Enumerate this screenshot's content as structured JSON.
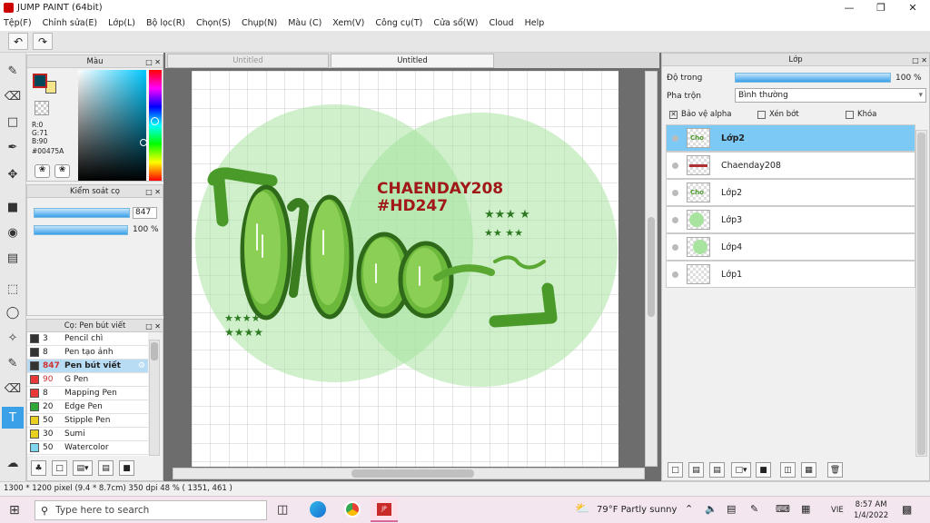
{
  "window": {
    "title": "JUMP PAINT (64bit)"
  },
  "menu": [
    "Tệp(F)",
    "Chỉnh sửa(E)",
    "Lớp(L)",
    "Bộ lọc(R)",
    "Chọn(S)",
    "Chụp(N)",
    "Màu (C)",
    "Xem(V)",
    "Công cụ(T)",
    "Cửa sổ(W)",
    "Cloud",
    "Help"
  ],
  "color_panel": {
    "title": "Màu",
    "r": "R:0",
    "g": "G:71",
    "b": "B:90",
    "hex": "#00475A",
    "fg_color": "#00475A",
    "bg_color": "#f6e58a"
  },
  "brush_control": {
    "title": "Kiểm soát cọ",
    "size": "847",
    "opacity": "100 %",
    "size_fraction": 1.0,
    "opacity_fraction": 1.0
  },
  "brush_list": {
    "title": "Cọ: Pen bút viết",
    "items": [
      {
        "num": "3",
        "name": "Pencil chì",
        "color": "#333333"
      },
      {
        "num": "8",
        "name": "Pen tạo ảnh",
        "color": "#333333"
      },
      {
        "num": "847",
        "name": "Pen bút viết",
        "color": "#333333",
        "selected": true
      },
      {
        "num": "90",
        "name": "G Pen",
        "color": "#e83838"
      },
      {
        "num": "8",
        "name": "Mapping Pen",
        "color": "#e83838"
      },
      {
        "num": "20",
        "name": "Edge Pen",
        "color": "#2ea836"
      },
      {
        "num": "50",
        "name": "Stipple Pen",
        "color": "#e8d020"
      },
      {
        "num": "30",
        "name": "Sumi",
        "color": "#e8d020"
      },
      {
        "num": "50",
        "name": "Watercolor",
        "color": "#7fd6f0"
      }
    ]
  },
  "doc_tabs": [
    "Untitled",
    "Untitled"
  ],
  "canvas": {
    "text1": "CHAENDAY208",
    "text2": "#HD247",
    "lettering": "Cho",
    "accent": "#a01818",
    "green": "#5aa832"
  },
  "layers_panel": {
    "title": "Lớp",
    "opacity_label": "Độ trong",
    "opacity_value": "100 %",
    "opacity_fraction": 1.0,
    "blend_label": "Pha trộn",
    "blend_value": "Bình thường",
    "protect_alpha": "Bảo vệ alpha",
    "clipping": "Xén bớt",
    "lock": "Khóa",
    "layers": [
      {
        "name": "Lớp2",
        "selected": true
      },
      {
        "name": "Chaenday208"
      },
      {
        "name": "Lớp2"
      },
      {
        "name": "Lớp3"
      },
      {
        "name": "Lớp4"
      },
      {
        "name": "Lớp1"
      }
    ]
  },
  "status": {
    "text": "1300 * 1200 pixel  (9.4 * 8.7cm)  350 dpi  48 %  ( 1351, 461 )"
  },
  "taskbar": {
    "search_placeholder": "Type here to search",
    "weather": "79°F  Partly sunny",
    "lang": "VIE",
    "time": "8:57 AM",
    "date": "1/4/2022"
  }
}
